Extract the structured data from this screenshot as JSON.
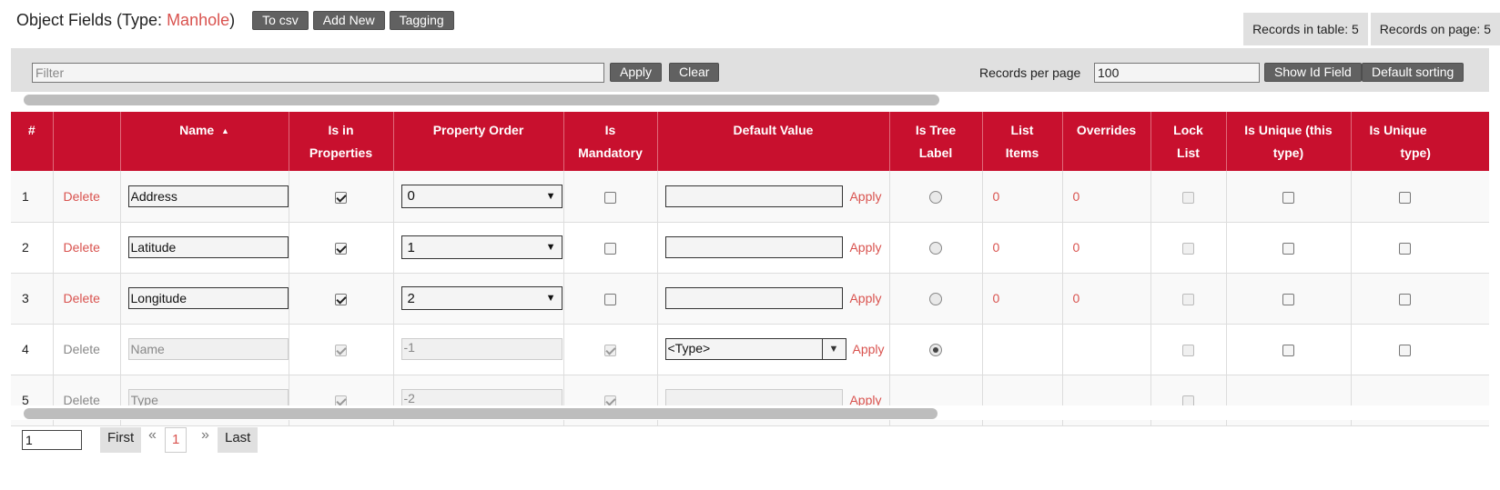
{
  "header": {
    "title_prefix": "Object Fields (Type: ",
    "type_name": "Manhole",
    "title_suffix": ")",
    "buttons": [
      "To csv",
      "Add New",
      "Tagging"
    ],
    "records_in_table": "Records in table: 5",
    "records_on_page": "Records on page: 5"
  },
  "filter": {
    "placeholder": "Filter",
    "apply_label": "Apply",
    "clear_label": "Clear",
    "rpp_label": "Records per page",
    "rpp_value": "100",
    "show_id_label": "Show Id Field",
    "default_sorting_label": "Default sorting"
  },
  "table": {
    "columns": {
      "num": "#",
      "name": "Name",
      "sort_indicator": "▲",
      "is_in_properties_1": "Is in",
      "is_in_properties_2": "Properties",
      "property_order": "Property Order",
      "is_mandatory_1": "Is",
      "is_mandatory_2": "Mandatory",
      "default_value": "Default Value",
      "is_tree_label_1": "Is Tree",
      "is_tree_label_2": "Label",
      "list_items_1": "List",
      "list_items_2": "Items",
      "overrides": "Overrides",
      "lock_list_1": "Lock",
      "lock_list_2": "List",
      "is_unique_this_1": "Is Unique (this",
      "is_unique_this_2": "type)",
      "is_unique_next_1": "Is Unique",
      "is_unique_next_2": "type)"
    },
    "rows": [
      {
        "num": "1",
        "delete": "Delete",
        "name": "Address",
        "order": "0",
        "default_value": "",
        "apply": "Apply",
        "list_items": "0",
        "overrides": "0"
      },
      {
        "num": "2",
        "delete": "Delete",
        "name": "Latitude",
        "order": "1",
        "default_value": "",
        "apply": "Apply",
        "list_items": "0",
        "overrides": "0"
      },
      {
        "num": "3",
        "delete": "Delete",
        "name": "Longitude",
        "order": "2",
        "default_value": "",
        "apply": "Apply",
        "list_items": "0",
        "overrides": "0"
      },
      {
        "num": "4",
        "delete": "Delete",
        "name": "Name",
        "order": "-1",
        "default_value": "<Type>",
        "apply": "Apply",
        "list_items": "",
        "overrides": ""
      },
      {
        "num": "5",
        "delete": "Delete",
        "name": "Type",
        "order": "-2",
        "default_value": "",
        "apply": "Apply",
        "list_items": "",
        "overrides": ""
      }
    ]
  },
  "pager": {
    "page_value": "1",
    "first": "First",
    "prev": "«",
    "current": "1",
    "next": "»",
    "last": "Last"
  },
  "colors": {
    "header_red": "#c8102e",
    "link_red": "#d9534f",
    "button_gray": "#616161"
  }
}
